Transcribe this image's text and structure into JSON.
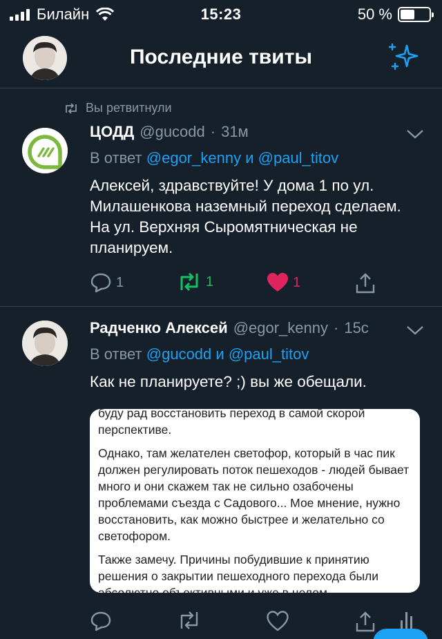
{
  "status_bar": {
    "carrier": "Билайн",
    "time": "15:23",
    "battery": "50 %",
    "battery_level": 0.5
  },
  "header": {
    "title": "Последние твиты",
    "avatar_icon": "profile-avatar",
    "action_icon": "sparkle-icon"
  },
  "tweets": [
    {
      "retweet_label": "Вы ретвитнули",
      "name": "ЦОДД",
      "handle": "@gucodd",
      "separator": "·",
      "time": "31м",
      "reply_prefix": "В ответ",
      "reply_mention_1": "@egor_kenny",
      "reply_and": "и",
      "reply_mention_2": "@paul_titov",
      "text": "Алексей, здравствуйте! У дома 1 по ул. Милашенкова наземный переход сделаем. На ул. Верхняя Сыромятническая не планируем.",
      "replies": "1",
      "retweets": "1",
      "likes": "1"
    },
    {
      "name": "Радченко Алексей",
      "handle": "@egor_kenny",
      "separator": "·",
      "time": "15с",
      "reply_prefix": "В ответ",
      "reply_mention_1": "@gucodd",
      "reply_and": "и",
      "reply_mention_2": "@paul_titov",
      "text": "Как не планируете? ;) вы же обещали.",
      "embed_paragraphs": [
        "буду рад восстановить переход в самой скорой перспективе.",
        "Однако, там желателен светофор, который в час пик должен регулировать поток пешеходов - людей бывает много и они скажем так не сильно озабочены проблемами съезда с Садового... Мое мнение, нужно восстановить, как можно быстрее и желательно со светофором.",
        "Также замечу. Причины побудившие к принятию решения о закрытии пешеходного перехода были абсолютно объективными и уже в целом"
      ]
    }
  ],
  "colors": {
    "background": "#15202b",
    "muted": "#8899a6",
    "accent": "#1da1f2",
    "retweet_green": "#17bf63",
    "like_red": "#e0245e",
    "divider": "#38444d"
  }
}
